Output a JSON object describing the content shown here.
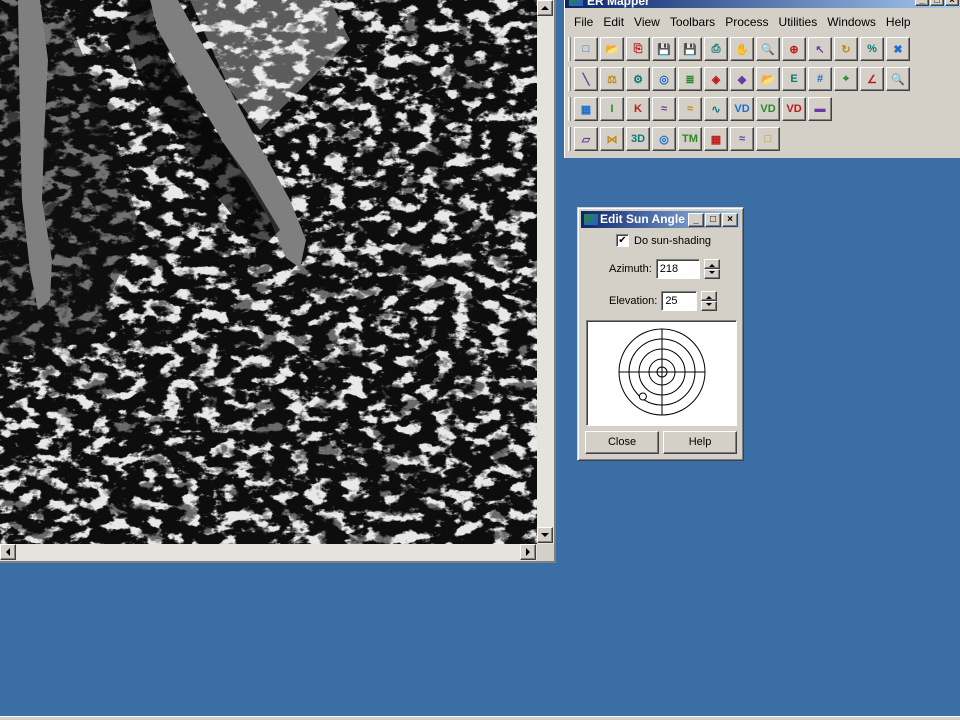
{
  "main_window": {
    "title": "ER Mapper",
    "menu": [
      "File",
      "Edit",
      "View",
      "Toolbars",
      "Process",
      "Utilities",
      "Windows",
      "Help"
    ],
    "toolbars": [
      [
        "new-icon",
        "open-icon",
        "copy-icon",
        "save-icon",
        "save-as-icon",
        "print-icon",
        "pan-hand-icon",
        "zoom-icon",
        "zoom-box-icon",
        "pointer-icon",
        "refresh-icon",
        "percent-icon",
        "stop-icon"
      ],
      [
        "pencil-icon",
        "balance-icon",
        "algorithm-icon",
        "fingerprint-icon",
        "layers-stack-icon",
        "geocode-icon",
        "layer-icon",
        "open-folder-icon",
        "formula-icon",
        "grid-icon",
        "crosshair-icon",
        "curve-icon",
        "magnify-globe-icon"
      ],
      [
        "mosaic-icon",
        "info-icon",
        "classify-icon",
        "wave-icon",
        "wave2-icon",
        "histogram-icon",
        "vd-icon",
        "vd2-icon",
        "vd3-icon",
        "colorbar-icon"
      ],
      [
        "parallelogram-icon",
        "bowtie-icon",
        "3d-icon",
        "fingerprint2-icon",
        "tm-icon",
        "mosaic2-icon",
        "wave3-icon",
        "frame-icon"
      ]
    ],
    "toolbar_glyphs": [
      [
        "□",
        "📂",
        "⎘",
        "💾",
        "💾",
        "⎙",
        "✋",
        "🔍",
        "⊕",
        "↖",
        "↻",
        "%",
        "✖"
      ],
      [
        "╲",
        "⚖",
        "⚙",
        "◎",
        "≣",
        "◈",
        "◆",
        "📂",
        "E",
        "#",
        "⌖",
        "∠",
        "🔍"
      ],
      [
        "▦",
        "I",
        "K",
        "≈",
        "≈",
        "∿",
        "VD",
        "VD",
        "VD",
        "▬"
      ],
      [
        "▱",
        "⋈",
        "3D",
        "◎",
        "TM",
        "▦",
        "≈",
        "□"
      ]
    ]
  },
  "sun_dialog": {
    "title": "Edit Sun Angle",
    "do_sun_shading_label": "Do sun-shading",
    "do_sun_shading_checked": "✔",
    "azimuth_label": "Azimuth:",
    "azimuth_value": "218",
    "elevation_label": "Elevation:",
    "elevation_value": "25",
    "close_label": "Close",
    "help_label": "Help"
  },
  "colors": {
    "desktop": "#3a6ea5",
    "title_active": "#0a246a",
    "face": "#d4d0c8"
  }
}
